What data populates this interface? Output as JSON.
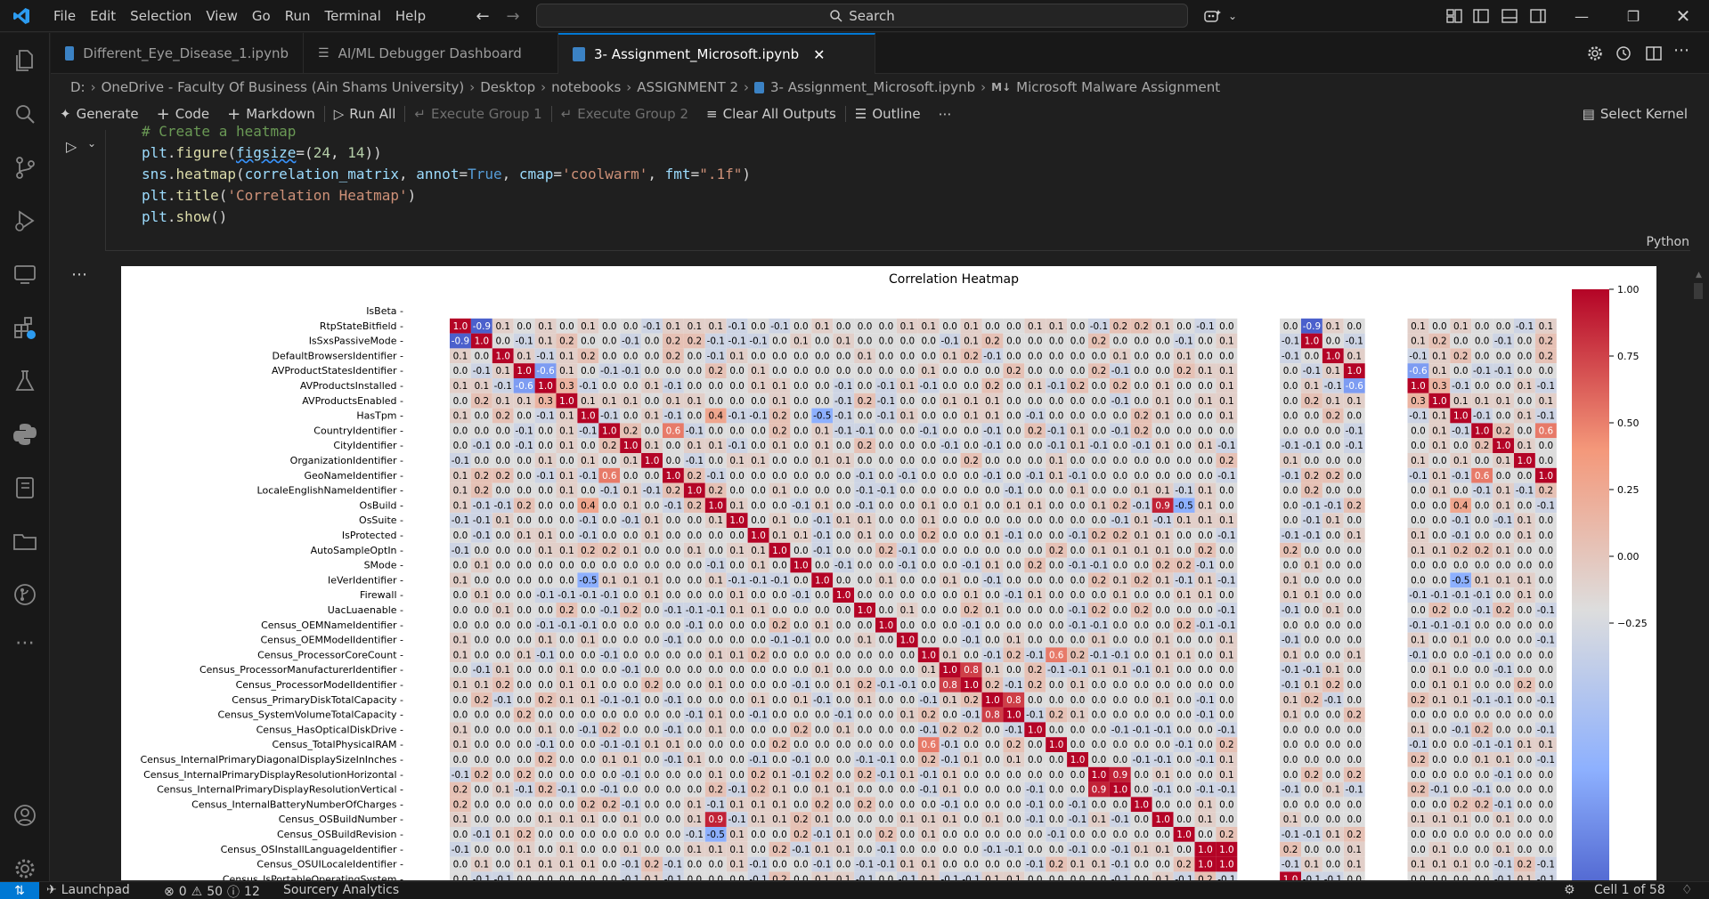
{
  "menu": [
    "File",
    "Edit",
    "Selection",
    "View",
    "Go",
    "Run",
    "Terminal",
    "Help"
  ],
  "search": {
    "label": "Search"
  },
  "tabs": [
    {
      "label": "Different_Eye_Disease_1.ipynb",
      "active": false
    },
    {
      "label": "AI/ML Debugger Dashboard",
      "active": false
    },
    {
      "label": "3- Assignment_Microsoft.ipynb",
      "active": true
    }
  ],
  "breadcrumb": [
    "D:",
    "OneDrive - Faculty Of Business (Ain Shams University)",
    "Desktop",
    "notebooks",
    "ASSIGNMENT 2",
    "3- Assignment_Microsoft.ipynb",
    "Microsoft Malware Assignment"
  ],
  "toolbar": {
    "generate": "Generate",
    "code": "Code",
    "markdown": "Markdown",
    "run_all": "Run All",
    "exec1": "Execute Group 1",
    "exec2": "Execute Group 2",
    "clear": "Clear All Outputs",
    "outline": "Outline",
    "kernel": "Select Kernel"
  },
  "cell": {
    "lines": [
      "# Create a heatmap",
      "plt.figure(figsize=(24, 14))",
      "sns.heatmap(correlation_matrix, annot=True, cmap='coolwarm', fmt=\".1f\")",
      "plt.title('Correlation Heatmap')",
      "plt.show()"
    ],
    "language": "Python"
  },
  "status": {
    "launchpad": "Launchpad",
    "errors": "0",
    "warnings": "50",
    "info": "12",
    "sourcery": "Sourcery Analytics",
    "cell_position": "Cell 1 of 58"
  },
  "chart_data": {
    "type": "heatmap",
    "title": "Correlation Heatmap",
    "colormap": "coolwarm",
    "colorbar_ticks": [
      "1.00",
      "0.75",
      "0.50",
      "0.25",
      "0.00",
      "−0.25"
    ],
    "rows": [
      "IsBeta",
      "RtpStateBitfield",
      "IsSxsPassiveMode",
      "DefaultBrowsersIdentifier",
      "AVProductStatesIdentifier",
      "AVProductsInstalled",
      "AVProductsEnabled",
      "HasTpm",
      "CountryIdentifier",
      "CityIdentifier",
      "OrganizationIdentifier",
      "GeoNameIdentifier",
      "LocaleEnglishNameIdentifier",
      "OsBuild",
      "OsSuite",
      "IsProtected",
      "AutoSampleOptIn",
      "SMode",
      "IeVerIdentifier",
      "Firewall",
      "UacLuaenable",
      "Census_OEMNameIdentifier",
      "Census_OEMModelIdentifier",
      "Census_ProcessorCoreCount",
      "Census_ProcessorManufacturerIdentifier",
      "Census_ProcessorModelIdentifier",
      "Census_PrimaryDiskTotalCapacity",
      "Census_SystemVolumeTotalCapacity",
      "Census_HasOpticalDiskDrive",
      "Census_TotalPhysicalRAM",
      "Census_InternalPrimaryDiagonalDisplaySizeInInches",
      "Census_InternalPrimaryDisplayResolutionHorizontal",
      "Census_InternalPrimaryDisplayResolutionVertical",
      "Census_InternalBatteryNumberOfCharges",
      "Census_OSBuildNumber",
      "Census_OSBuildRevision",
      "Census_OSInstallLanguageIdentifier",
      "Census_OSUILocaleIdentifier",
      "Census_IsPortableOperatingSystem"
    ],
    "diagonal_value": 1.0,
    "notable": [
      {
        "row": "RtpStateBitfield",
        "col": "IsSxsPassiveMode",
        "value": -0.9
      },
      {
        "row": "AVProductStatesIdentifier",
        "col": "AVProductsInstalled",
        "value": -0.6
      },
      {
        "row": "AVProductsInstalled",
        "col": "AVProductsEnabled",
        "value": 0.3
      },
      {
        "row": "CountryIdentifier",
        "col": "GeoNameIdentifier",
        "value": 0.6
      },
      {
        "row": "OsBuild",
        "col": "Census_OSBuildNumber",
        "value": 0.9
      },
      {
        "row": "OsBuild",
        "col": "Census_OSBuildRevision",
        "value": -0.5
      },
      {
        "row": "HasTpm",
        "col": "OsBuild",
        "value": 0.4
      },
      {
        "row": "HasTpm",
        "col": "IeVerIdentifier",
        "value": -0.5
      },
      {
        "row": "Census_ProcessorManufacturerIdentifier",
        "col": "Census_ProcessorModelIdentifier",
        "value": 0.8
      },
      {
        "row": "Census_PrimaryDiskTotalCapacity",
        "col": "Census_SystemVolumeTotalCapacity",
        "value": 0.8
      },
      {
        "row": "Census_InternalPrimaryDisplayResolutionHorizontal",
        "col": "Census_InternalPrimaryDisplayResolutionVertical",
        "value": 0.9
      },
      {
        "row": "Census_TotalPhysicalRAM",
        "col": "Census_ProcessorCoreCount",
        "value": 0.6
      },
      {
        "row": "Census_OSInstallLanguageIdentifier",
        "col": "Census_OSUILocaleIdentifier",
        "value": 1.0
      }
    ]
  }
}
